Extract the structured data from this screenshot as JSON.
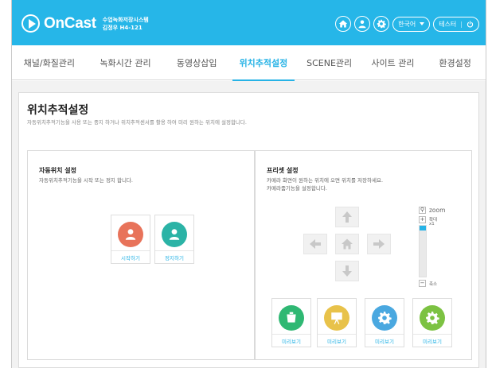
{
  "header": {
    "app_name": "OnCast",
    "sub_line1": "수업녹화저장시스템",
    "sub_line2": "김정우 H4-121",
    "language": "한국어",
    "user_button": "테스터",
    "icons": [
      "home-icon",
      "user-icon",
      "gear-icon",
      "power-icon"
    ],
    "accent_color": "#26b6e8"
  },
  "nav": {
    "items": [
      {
        "label": "채널/화질관리",
        "active": false
      },
      {
        "label": "녹화시간 관리",
        "active": false
      },
      {
        "label": "동영상삽입",
        "active": false
      },
      {
        "label": "위치추적설정",
        "active": true
      },
      {
        "label": "SCENE관리",
        "active": false
      },
      {
        "label": "사이트 관리",
        "active": false
      },
      {
        "label": "환경설정",
        "active": false
      }
    ]
  },
  "page": {
    "title": "위치추적설정",
    "description": "자동위치추적기능을 사용 또는 중지 하거나 위치추적센서를 활용 하여 미리 원하는 위치에 설정합니다."
  },
  "auto_panel": {
    "title": "자동위치 설정",
    "description": "자동위치추적기능을 시작 또는 정지 합니다.",
    "start_label": "시작하기",
    "stop_label": "정지하기",
    "start_color": "#e8735a",
    "stop_color": "#2bb3a6"
  },
  "preset_panel": {
    "title": "프리셋 설정",
    "description_line1": "카메라 화면이 원하는 위치에 오면 위치를 저장하세요.",
    "description_line2": "카메라줌기능을 설정합니다.",
    "zoom": {
      "label": "zoom",
      "max_label": "확대",
      "level_label": "x1",
      "min_label": "축소",
      "level_fraction": 0.1
    },
    "presets": [
      {
        "label": "미리보기",
        "color": "#2fb873",
        "icon": "camera-icon"
      },
      {
        "label": "미리보기",
        "color": "#e8c24a",
        "icon": "presentation-icon"
      },
      {
        "label": "미리보기",
        "color": "#4aa8e0",
        "icon": "gear-icon"
      },
      {
        "label": "미리보기",
        "color": "#7cc242",
        "icon": "gear-icon"
      }
    ]
  }
}
